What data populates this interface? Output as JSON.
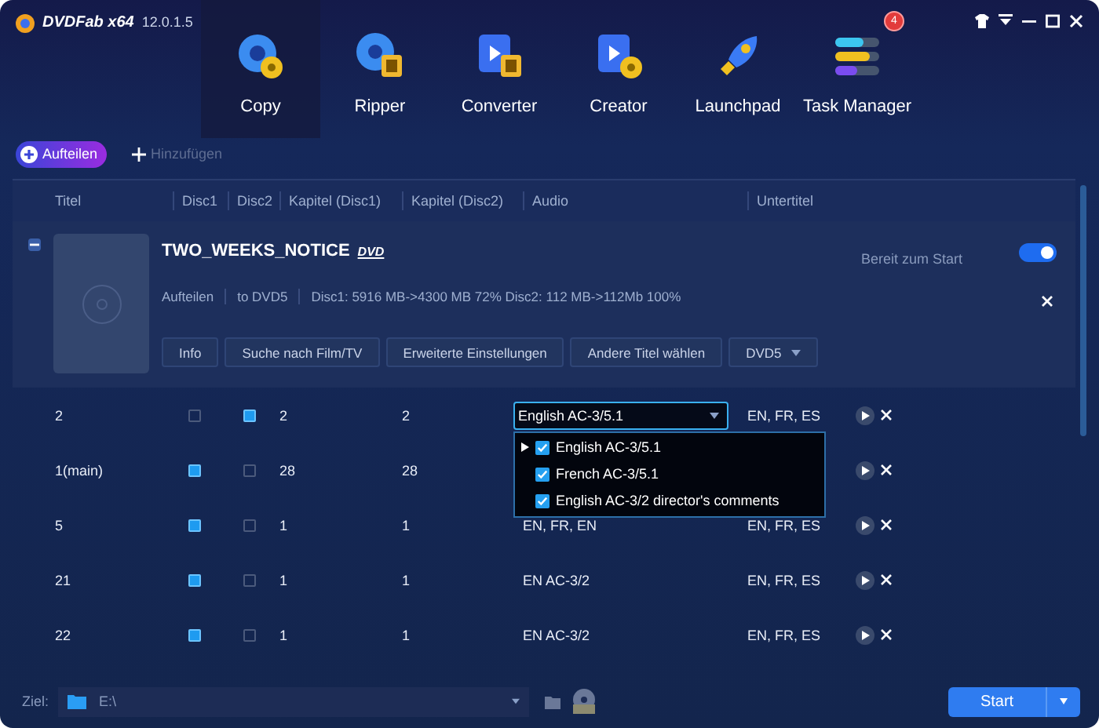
{
  "window": {
    "brand": "DVDFab x64",
    "version": "12.0.1.5"
  },
  "modules": [
    {
      "label": "Copy",
      "kind": "copy",
      "selected": true
    },
    {
      "label": "Ripper",
      "kind": "ripper",
      "selected": false
    },
    {
      "label": "Converter",
      "kind": "converter",
      "selected": false
    },
    {
      "label": "Creator",
      "kind": "creator",
      "selected": false
    },
    {
      "label": "Launchpad",
      "kind": "launchpad",
      "selected": false
    },
    {
      "label": "Task Manager",
      "kind": "tasks",
      "selected": false,
      "badge": "4"
    }
  ],
  "toolbar": {
    "split": "Aufteilen",
    "add": {
      "label": "Hinzufügen",
      "disabled": true
    }
  },
  "columns": [
    "Titel",
    "Disc1",
    "Disc2",
    "Kapitel (Disc1)",
    "Kapitel (Disc2)",
    "Audio",
    "Untertitel"
  ],
  "disc": {
    "expanded": true,
    "title": "TWO_WEEKS_NOTICE",
    "format_logo": "DVD",
    "status": "Bereit zum Start",
    "enabled": true,
    "info": [
      "Aufteilen",
      "to DVD5",
      "Disc1: 5916 MB->4300 MB 72% Disc2: 112 MB->112Mb 100%"
    ],
    "buttons": [
      "Info",
      "Suche nach Film/TV",
      "Erweiterte Einstellungen",
      "Andere Titel wählen"
    ],
    "target": "DVD5"
  },
  "rows": [
    {
      "title": "2",
      "disc1": false,
      "disc2": true,
      "chapters1": "2",
      "chapters2": "2",
      "audio": "English AC-3/5.1",
      "audio_open": true,
      "subtitles": "EN, FR, ES"
    },
    {
      "title": "1(main)",
      "disc1": true,
      "disc2": false,
      "chapters1": "28",
      "chapters2": "28"
    },
    {
      "title": "5",
      "disc1": true,
      "disc2": false,
      "chapters1": "1",
      "chapters2": "1",
      "audio": "EN, FR, EN",
      "subtitles": "EN, FR, ES"
    },
    {
      "title": "21",
      "disc1": true,
      "disc2": false,
      "chapters1": "1",
      "chapters2": "1",
      "audio": "EN  AC-3/2",
      "subtitles": "EN, FR, ES"
    },
    {
      "title": "22",
      "disc1": true,
      "disc2": false,
      "chapters1": "1",
      "chapters2": "1",
      "audio": "EN  AC-3/2",
      "subtitles": "EN, FR, ES"
    }
  ],
  "audio_menu": [
    {
      "label": "English AC-3/5.1",
      "checked": true,
      "current": true
    },
    {
      "label": "French AC-3/5.1",
      "checked": true,
      "current": false
    },
    {
      "label": "English AC-3/2 director's comments",
      "checked": true,
      "current": false
    }
  ],
  "footer": {
    "label": "Ziel:",
    "path": "E:\\",
    "start": "Start"
  }
}
